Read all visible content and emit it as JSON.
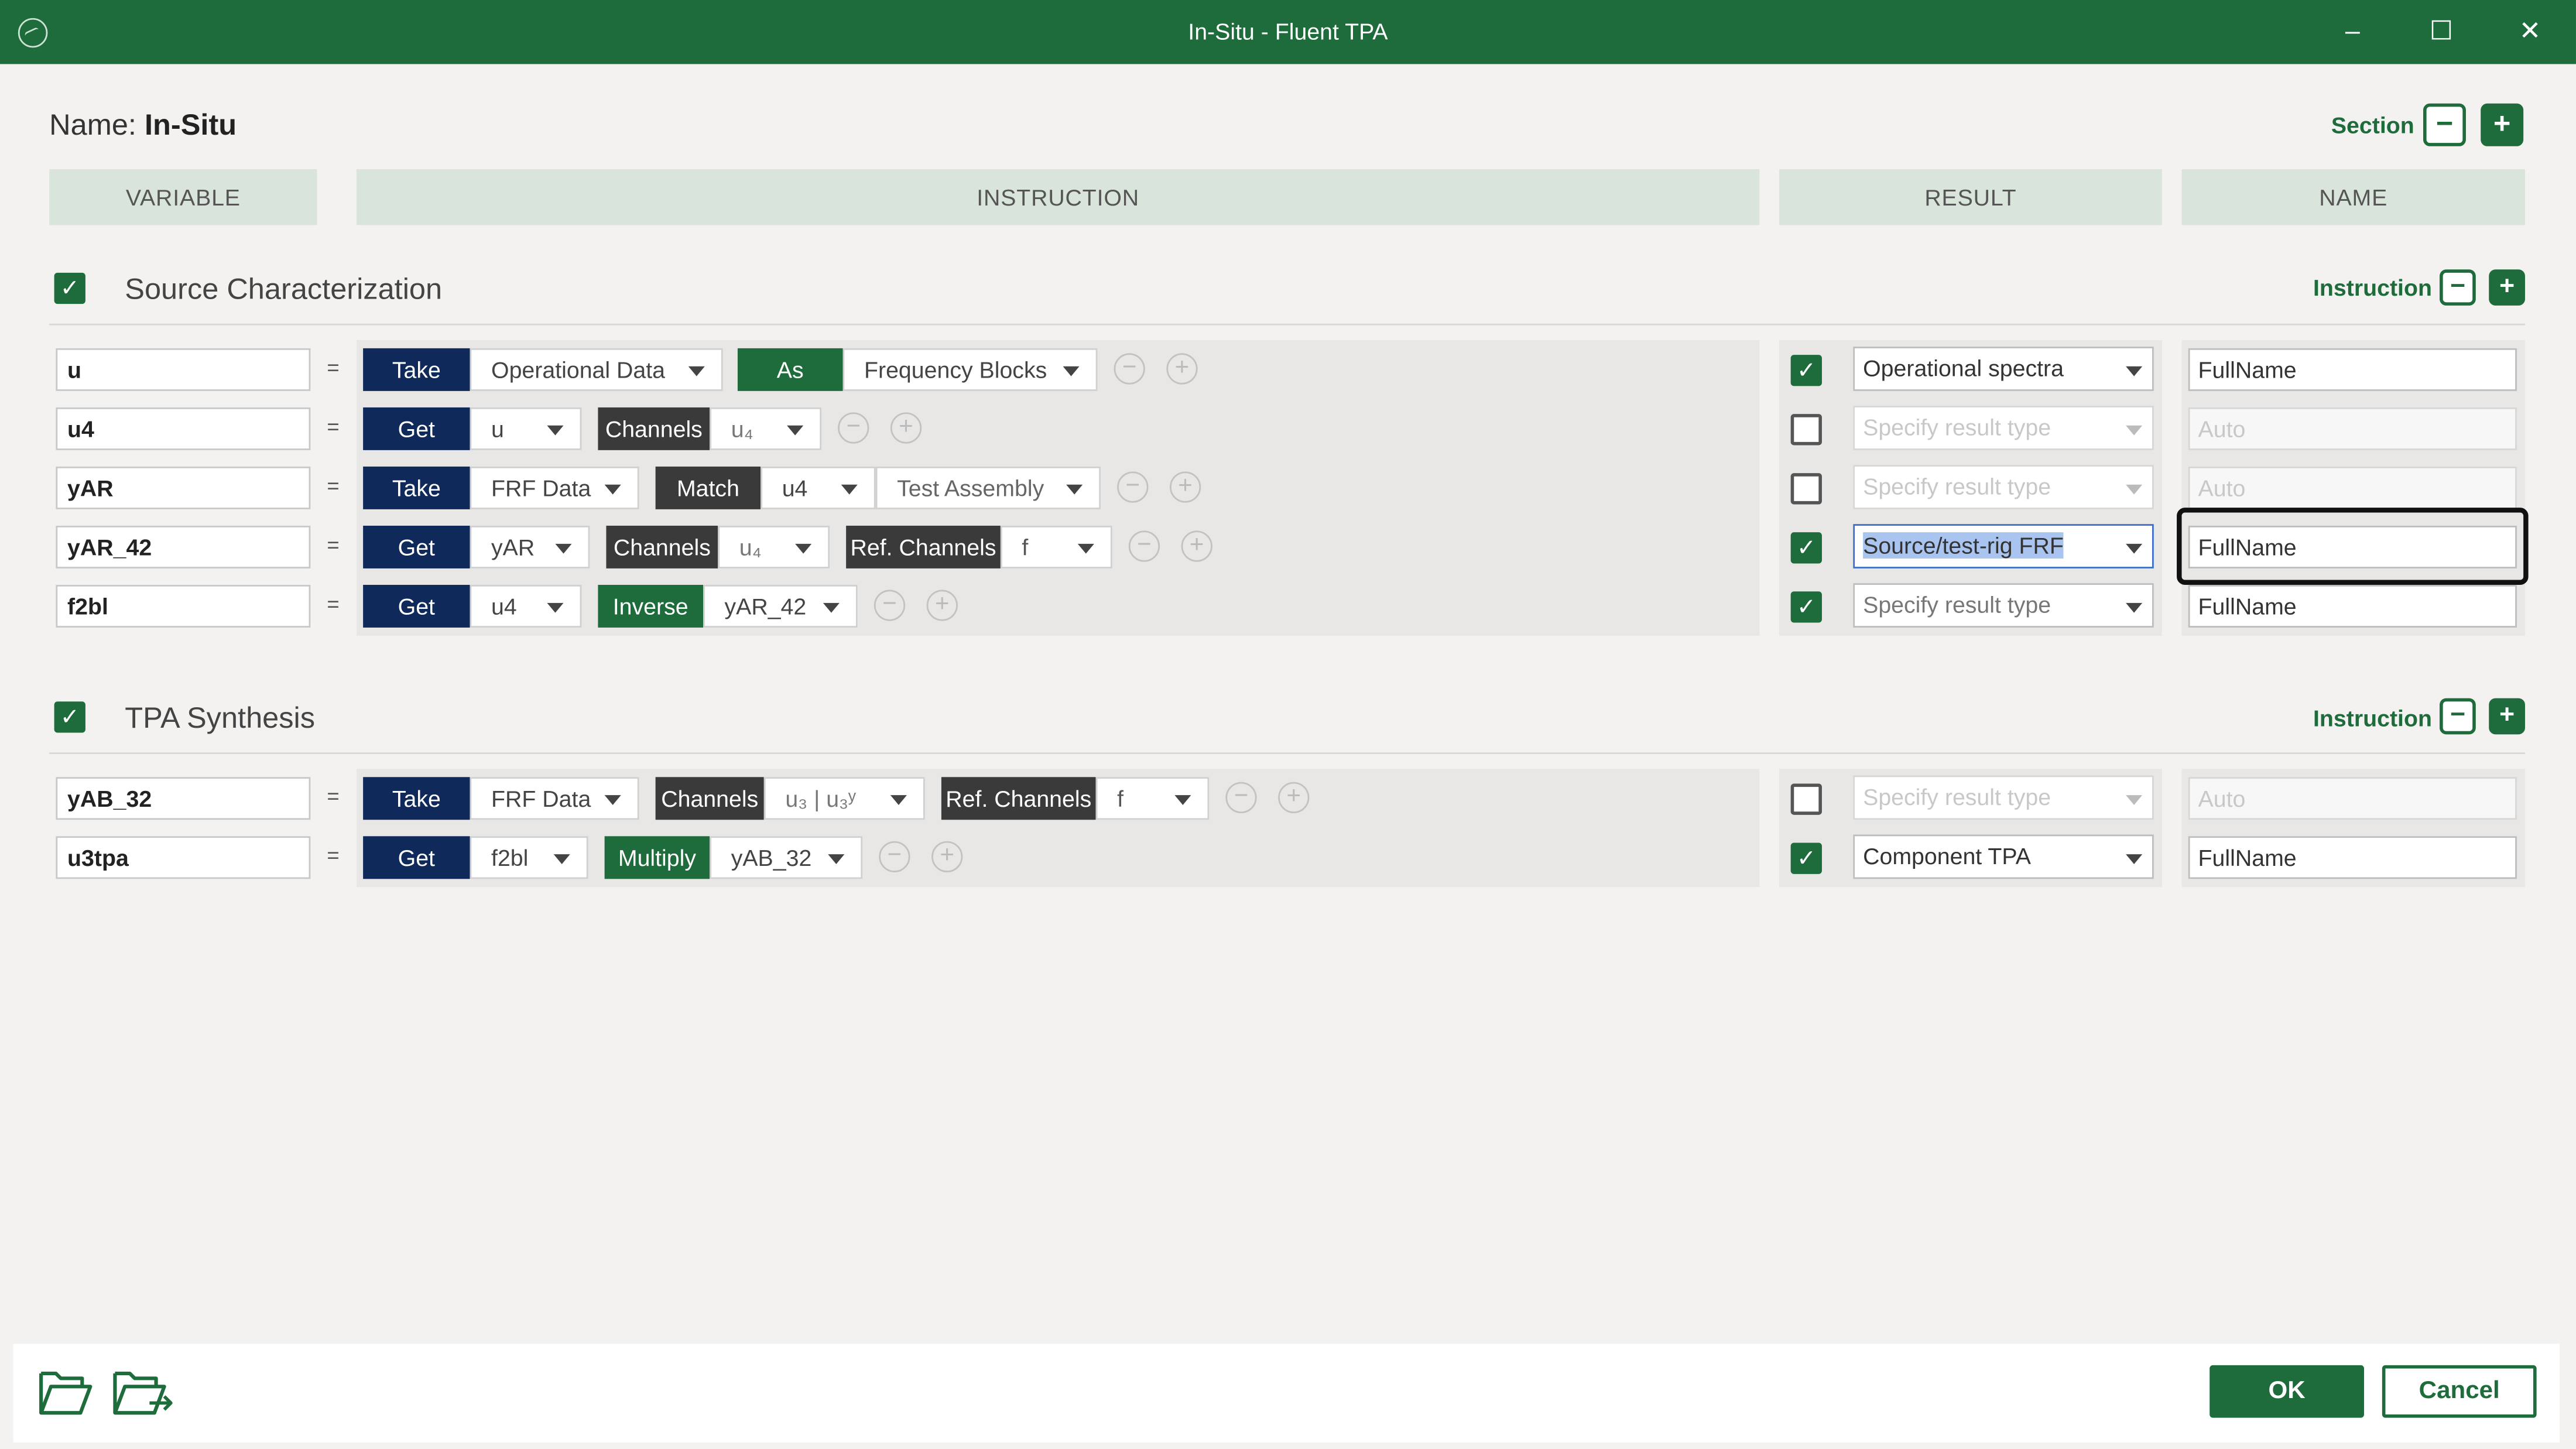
{
  "window": {
    "title": "In-Situ - Fluent TPA",
    "minimize": "–",
    "maximize": "☐",
    "close": "✕"
  },
  "header": {
    "name_label": "Name:",
    "name_value": "In-Situ",
    "section_label": "Section",
    "minus": "−",
    "plus": "+"
  },
  "columns": {
    "variable": "VARIABLE",
    "instruction": "INSTRUCTION",
    "result": "RESULT",
    "name": "NAME"
  },
  "sections": [
    {
      "title": "Source Characterization",
      "checked": true,
      "instruction_label": "Instruction",
      "rows": [
        {
          "variable": "u",
          "eq": "=",
          "parts": [
            "Take",
            "Operational Data",
            "As",
            "Frequency Blocks"
          ],
          "result_checked": true,
          "result": "Operational spectra",
          "name": "FullName"
        },
        {
          "variable": "u4",
          "eq": "=",
          "parts": [
            "Get",
            "u",
            "Channels",
            "u₄"
          ],
          "result_checked": false,
          "result": "Specify result type",
          "name": "Auto"
        },
        {
          "variable": "yAR",
          "eq": "=",
          "parts": [
            "Take",
            "FRF Data",
            "Match",
            "u4",
            "Test Assembly"
          ],
          "result_checked": false,
          "result": "Specify result type",
          "name": "Auto"
        },
        {
          "variable": "yAR_42",
          "eq": "=",
          "parts": [
            "Get",
            "yAR",
            "Channels",
            "u₄",
            "Ref. Channels",
            "f"
          ],
          "result_checked": true,
          "result": "Source/test-rig FRF",
          "name": "FullName"
        },
        {
          "variable": "f2bl",
          "eq": "=",
          "parts": [
            "Get",
            "u4",
            "Inverse",
            "yAR_42"
          ],
          "result_checked": true,
          "result": "Specify result type",
          "name": "FullName"
        }
      ]
    },
    {
      "title": "TPA Synthesis",
      "checked": true,
      "instruction_label": "Instruction",
      "rows": [
        {
          "variable": "yAB_32",
          "eq": "=",
          "parts": [
            "Take",
            "FRF Data",
            "Channels",
            "u₃ | u₃ʸ",
            "Ref. Channels",
            "f"
          ],
          "result_checked": false,
          "result": "Specify result type",
          "name": "Auto"
        },
        {
          "variable": "u3tpa",
          "eq": "=",
          "parts": [
            "Get",
            "f2bl",
            "Multiply",
            "yAB_32"
          ],
          "result_checked": true,
          "result": "Component TPA",
          "name": "FullName"
        }
      ]
    }
  ],
  "icons": {
    "check": "✓",
    "minus_circle": "−",
    "plus_circle": "+"
  },
  "footer": {
    "ok": "OK",
    "cancel": "Cancel"
  },
  "colors": {
    "brand_green": "#1e6b3b",
    "navy": "#0f2a5a",
    "dark": "#3a3a3a",
    "selection": "#a9c4ee"
  }
}
